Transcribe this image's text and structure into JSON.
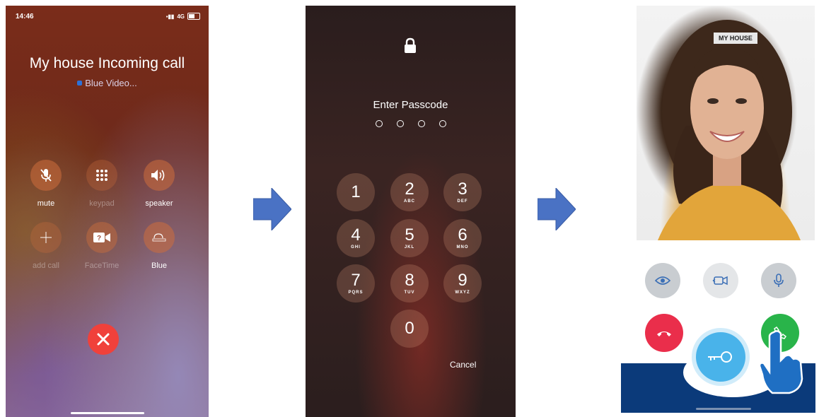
{
  "screen1": {
    "status_time": "14:46",
    "status_network": "4G",
    "caller": "My house Incoming call",
    "app_name": "Blue Video...",
    "buttons": [
      {
        "label": "mute",
        "icon": "mic-slash-icon"
      },
      {
        "label": "keypad",
        "icon": "keypad-icon"
      },
      {
        "label": "speaker",
        "icon": "speaker-icon"
      },
      {
        "label": "add call",
        "icon": "plus-icon"
      },
      {
        "label": "FaceTime",
        "icon": "facetime-icon"
      },
      {
        "label": "Blue",
        "icon": "blue-app-icon"
      }
    ],
    "decline_icon": "close-icon"
  },
  "screen2": {
    "title": "Enter Passcode",
    "keys": [
      {
        "num": "1",
        "letters": ""
      },
      {
        "num": "2",
        "letters": "ABC"
      },
      {
        "num": "3",
        "letters": "DEF"
      },
      {
        "num": "4",
        "letters": "GHI"
      },
      {
        "num": "5",
        "letters": "JKL"
      },
      {
        "num": "6",
        "letters": "MNO"
      },
      {
        "num": "7",
        "letters": "PQRS"
      },
      {
        "num": "8",
        "letters": "TUV"
      },
      {
        "num": "9",
        "letters": "WXYZ"
      },
      {
        "num": "0",
        "letters": ""
      }
    ],
    "cancel": "Cancel"
  },
  "screen3": {
    "video_label": "MY HOUSE",
    "colors": {
      "eye": "#c9cdd1",
      "camera": "#e4e6e8",
      "mic": "#c9cdd1",
      "hangup": "#ea2e4b",
      "answer": "#29b44a",
      "key": "#49b3ea",
      "band": "#0b3a7a"
    }
  },
  "arrow_color": "#4a72c4"
}
